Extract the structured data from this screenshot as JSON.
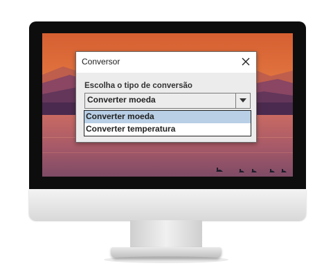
{
  "window": {
    "title": "Conversor"
  },
  "form": {
    "prompt_label": "Escolha o tipo de conversão",
    "selected_value": "Converter moeda",
    "options": [
      "Converter moeda",
      "Converter temperatura"
    ],
    "highlighted_index": 0
  },
  "icons": {
    "close": "close-icon",
    "dropdown_arrow": "chevron-down-icon"
  },
  "colors": {
    "highlight": "#b8cfe5",
    "dialog_bg": "#ececec",
    "bezel": "#0d0d0d"
  }
}
